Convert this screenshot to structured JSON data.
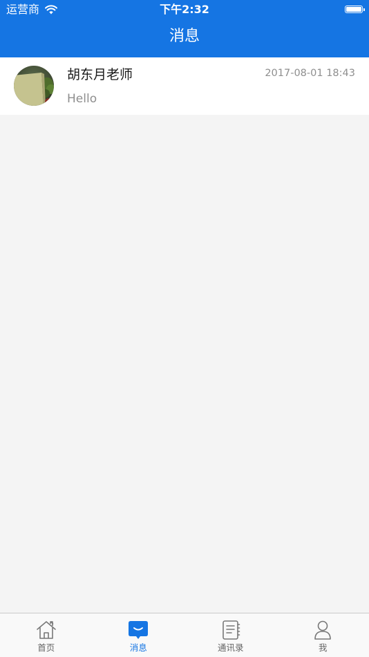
{
  "status_bar": {
    "carrier": "运营商",
    "time": "下午2:32",
    "battery_level": 1.0
  },
  "header": {
    "title": "消息"
  },
  "colors": {
    "primary": "#1575e3",
    "background": "#f4f4f4",
    "secondary_text": "#8e8e8e"
  },
  "messages": [
    {
      "sender": "胡东月老师",
      "time": "2017-08-01 18:43",
      "preview": "Hello"
    }
  ],
  "tab_bar": {
    "active_index": 1,
    "tabs": [
      {
        "label": "首页",
        "icon": "home-icon"
      },
      {
        "label": "消息",
        "icon": "message-icon"
      },
      {
        "label": "通讯录",
        "icon": "contacts-icon"
      },
      {
        "label": "我",
        "icon": "profile-icon"
      }
    ]
  }
}
